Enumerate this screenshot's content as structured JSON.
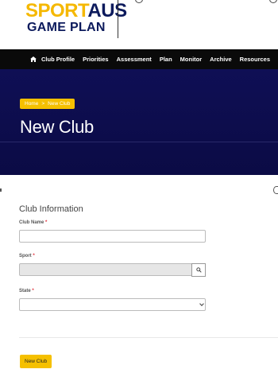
{
  "brand": {
    "logo_top_1": "SPORT",
    "logo_top_2": "AUS",
    "logo_bottom": "GAME PLAN"
  },
  "nav": {
    "items": [
      "Club Profile",
      "Priorities",
      "Assessment",
      "Plan",
      "Monitor",
      "Archive",
      "Resources"
    ]
  },
  "hero": {
    "breadcrumb": {
      "home": "Home",
      "separator": ">",
      "current": "New Club"
    },
    "title": "New Club"
  },
  "form": {
    "section_title": "Club Information",
    "fields": {
      "club_name": {
        "label": "Club Name",
        "required": "*",
        "value": ""
      },
      "sport": {
        "label": "Sport",
        "required": "*",
        "value": ""
      },
      "state": {
        "label": "State",
        "required": "*",
        "value": ""
      }
    },
    "submit_label": "New Club"
  },
  "colors": {
    "accent": "#f5c000",
    "hero_bg": "#0c0c4d",
    "nav_bg": "#0a0a0a",
    "brand_navy": "#0c1a5c",
    "required": "#e0303a"
  },
  "icons": [
    "home-icon",
    "search-icon",
    "chevron-down-icon"
  ]
}
